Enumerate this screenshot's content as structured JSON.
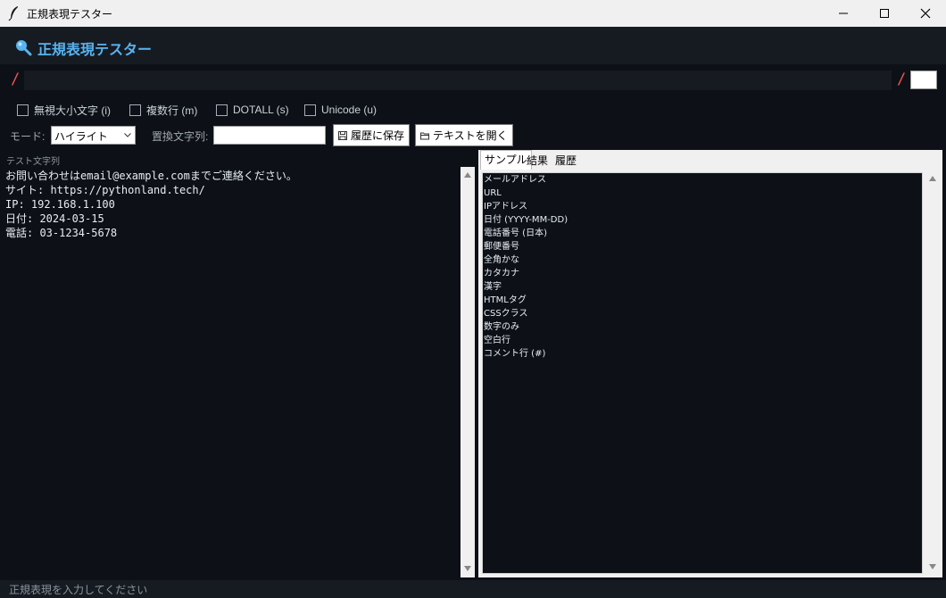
{
  "window": {
    "title": "正規表現テスター"
  },
  "header": {
    "title": "正規表現テスター"
  },
  "regex": {
    "open_slash": "/",
    "close_slash": "/",
    "pattern": "",
    "flags": ""
  },
  "options": [
    {
      "label": "無視大小文字 (i)",
      "checked": false
    },
    {
      "label": "複数行 (m)",
      "checked": false
    },
    {
      "label": "DOTALL (s)",
      "checked": false
    },
    {
      "label": "Unicode (u)",
      "checked": false
    }
  ],
  "controls": {
    "mode_label": "モード:",
    "mode_value": "ハイライト",
    "replace_label": "置換文字列:",
    "replace_value": "",
    "save_history": "履歴に保存",
    "open_text": "テキストを開く"
  },
  "test": {
    "label": "テスト文字列",
    "lines": [
      "お問い合わせはemail@example.comまでご連絡ください。",
      "サイト: https://pythonland.tech/",
      "IP: 192.168.1.100",
      "日付: 2024-03-15",
      "電話: 03-1234-5678"
    ]
  },
  "tabs": [
    {
      "label": "サンプル",
      "active": true
    },
    {
      "label": "結果",
      "active": false
    },
    {
      "label": "履歴",
      "active": false
    }
  ],
  "samples": [
    "メールアドレス",
    "URL",
    "IPアドレス",
    "日付 (YYYY-MM-DD)",
    "電話番号 (日本)",
    "郵便番号",
    "全角かな",
    "カタカナ",
    "漢字",
    "HTMLタグ",
    "CSSクラス",
    "数字のみ",
    "空白行",
    "コメント行 (#)"
  ],
  "status": {
    "text": "正規表現を入力してください"
  },
  "colors": {
    "accent": "#58b4f0",
    "slash": "#f0564b",
    "background": "#0d1117",
    "header": "#161b22"
  }
}
